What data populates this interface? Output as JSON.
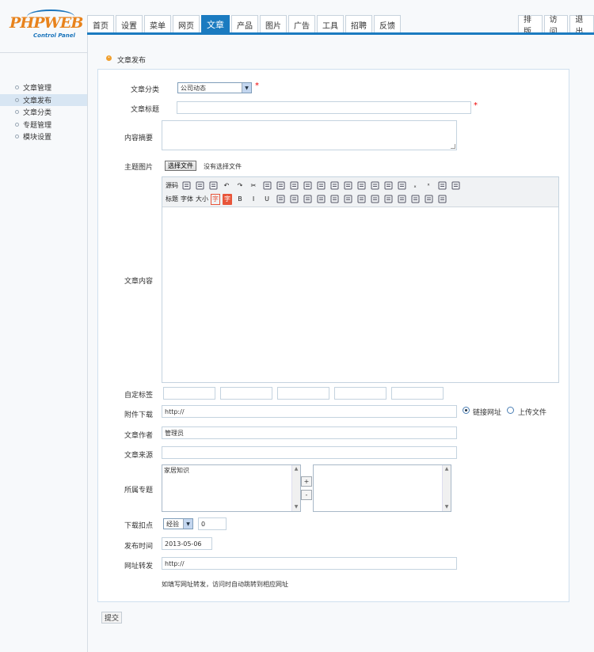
{
  "brand": {
    "logo_text": "PHPWEB",
    "logo_sub": "Control Panel"
  },
  "nav": {
    "left_tabs": [
      "首页",
      "设置",
      "菜单",
      "网页",
      "文章",
      "产品",
      "图片",
      "广告",
      "工具",
      "招聘",
      "反馈"
    ],
    "active_index": 4,
    "right_tabs": [
      "排版",
      "访问",
      "退出"
    ]
  },
  "sidebar": {
    "items": [
      "文章管理",
      "文章发布",
      "文章分类",
      "专题管理",
      "模块设置"
    ],
    "active_index": 1
  },
  "breadcrumb": "文章发布",
  "form": {
    "category_label": "文章分类",
    "category_value": "公司动态",
    "title_label": "文章标题",
    "title_value": "",
    "summary_label": "内容摘要",
    "image_label": "主题图片",
    "file_button": "选择文件",
    "file_status": "没有选择文件",
    "content_label": "文章内容",
    "toolbar_row1": [
      "源码",
      "",
      "",
      "",
      "↶",
      "↷",
      "✂",
      "",
      "",
      "",
      "",
      "",
      "",
      "",
      "",
      "",
      "",
      "",
      "ₓ",
      "ˣ",
      "",
      ""
    ],
    "toolbar_row2": [
      "标题",
      "字体",
      "大小",
      "字",
      "字",
      "B",
      "I",
      "U",
      "",
      "",
      "",
      "",
      "",
      "",
      "",
      "",
      "",
      "",
      "",
      "",
      ""
    ],
    "tags_label": "自定标签",
    "attachment_label": "附件下载",
    "attachment_value": "http://",
    "link_radio_label": "链接网址",
    "upload_radio_label": "上传文件",
    "author_label": "文章作者",
    "author_value": "管理员",
    "source_label": "文章来源",
    "source_value": "",
    "topic_label": "所属专题",
    "topic_options": [
      "家居知识"
    ],
    "add_button": "+",
    "remove_button": "-",
    "points_label": "下载扣点",
    "points_type": "经验",
    "points_value": "0",
    "time_label": "发布时间",
    "time_value": "2013-05-06",
    "redirect_label": "网址转发",
    "redirect_value": "http://",
    "redirect_hint": "如填写网址转发，访问时自动跳转到相应网址",
    "submit_label": "提交"
  },
  "colors": {
    "accent": "#1b7bc0",
    "sidebar_active": "#d8e6f3",
    "required": "#ee0000"
  }
}
